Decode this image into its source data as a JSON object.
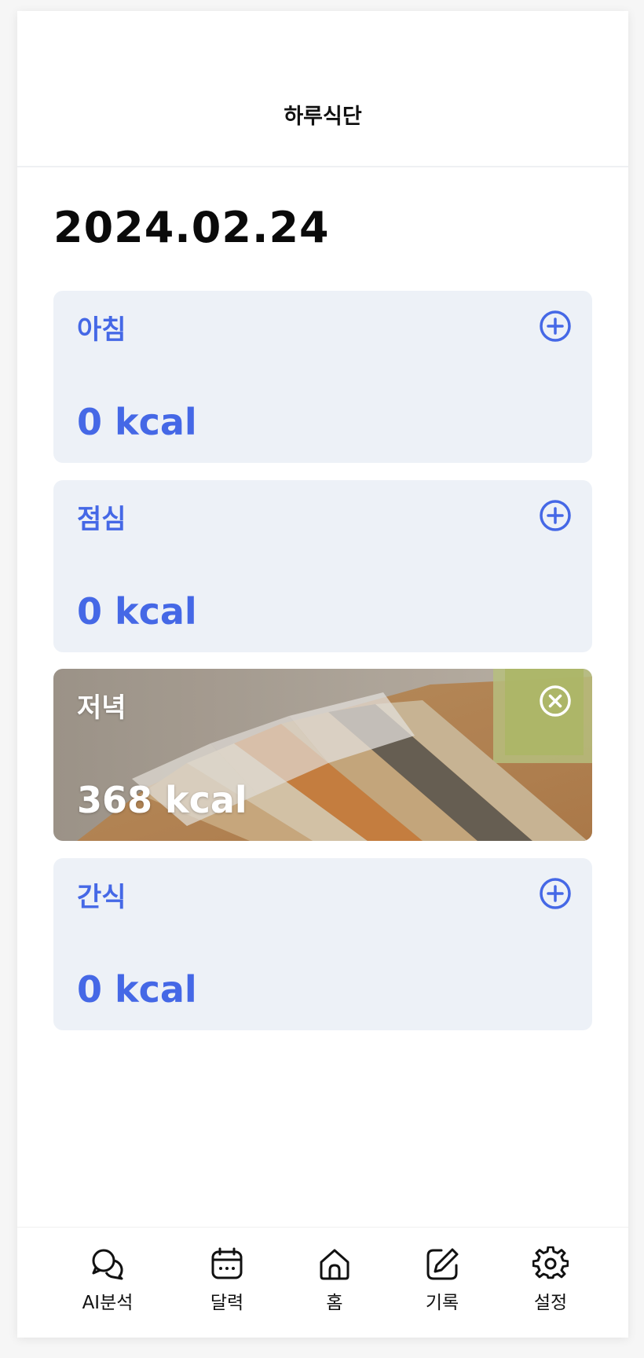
{
  "header": {
    "title": "하루식단"
  },
  "date": "2024.02.24",
  "meals": [
    {
      "name": "아침",
      "kcal": "0 kcal",
      "action_icon": "plus-circle-icon"
    },
    {
      "name": "점심",
      "kcal": "0 kcal",
      "action_icon": "plus-circle-icon"
    },
    {
      "name": "저녁",
      "kcal": "368 kcal",
      "action_icon": "close-circle-icon",
      "has_photo": true
    },
    {
      "name": "간식",
      "kcal": "0 kcal",
      "action_icon": "plus-circle-icon"
    }
  ],
  "tabs": [
    {
      "label": "AI분석",
      "icon": "chat-bubbles-icon"
    },
    {
      "label": "달력",
      "icon": "calendar-icon"
    },
    {
      "label": "홈",
      "icon": "home-icon"
    },
    {
      "label": "기록",
      "icon": "edit-icon"
    },
    {
      "label": "설정",
      "icon": "gear-icon"
    }
  ],
  "colors": {
    "accent": "#4568e6",
    "card_bg": "#edf1f7",
    "text": "#111111"
  }
}
